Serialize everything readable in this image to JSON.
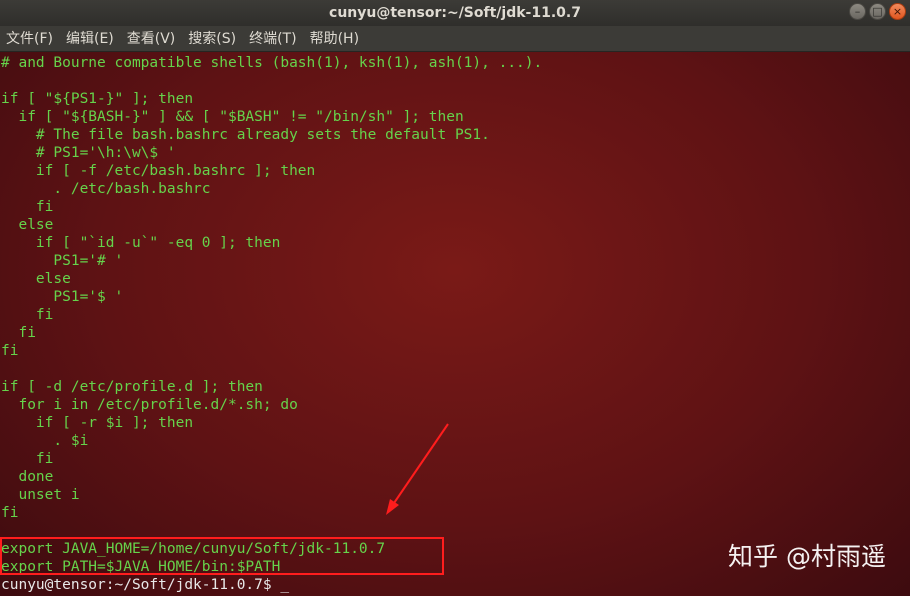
{
  "window": {
    "title": "cunyu@tensor:~/Soft/jdk-11.0.7",
    "buttons": [
      {
        "name": "minimize-button",
        "glyph": "–"
      },
      {
        "name": "maximize-button",
        "glyph": "□"
      },
      {
        "name": "close-button",
        "glyph": "×"
      }
    ]
  },
  "menu": {
    "items": [
      "文件(F)",
      "编辑(E)",
      "查看(V)",
      "搜索(S)",
      "终端(T)",
      "帮助(H)"
    ]
  },
  "terminal": {
    "lines": [
      "# and Bourne compatible shells (bash(1), ksh(1), ash(1), ...).",
      "",
      "if [ \"${PS1-}\" ]; then",
      "  if [ \"${BASH-}\" ] && [ \"$BASH\" != \"/bin/sh\" ]; then",
      "    # The file bash.bashrc already sets the default PS1.",
      "    # PS1='\\h:\\w\\$ '",
      "    if [ -f /etc/bash.bashrc ]; then",
      "      . /etc/bash.bashrc",
      "    fi",
      "  else",
      "    if [ \"`id -u`\" -eq 0 ]; then",
      "      PS1='# '",
      "    else",
      "      PS1='$ '",
      "    fi",
      "  fi",
      "fi",
      "",
      "if [ -d /etc/profile.d ]; then",
      "  for i in /etc/profile.d/*.sh; do",
      "    if [ -r $i ]; then",
      "      . $i",
      "    fi",
      "  done",
      "  unset i",
      "fi",
      "",
      "export JAVA_HOME=/home/cunyu/Soft/jdk-11.0.7",
      "export PATH=$JAVA_HOME/bin:$PATH"
    ],
    "prompt": "cunyu@tensor:~/Soft/jdk-11.0.7$ ",
    "cursor": "_"
  },
  "annotation": {
    "color": "#ff1d1d"
  },
  "watermark": {
    "text": "知乎 @村雨遥"
  },
  "colors": {
    "terminal_text": "#66d34b",
    "prompt_text": "#e8e8e8",
    "terminal_background": "#5e1214",
    "titlebar": "#3c3b37"
  }
}
